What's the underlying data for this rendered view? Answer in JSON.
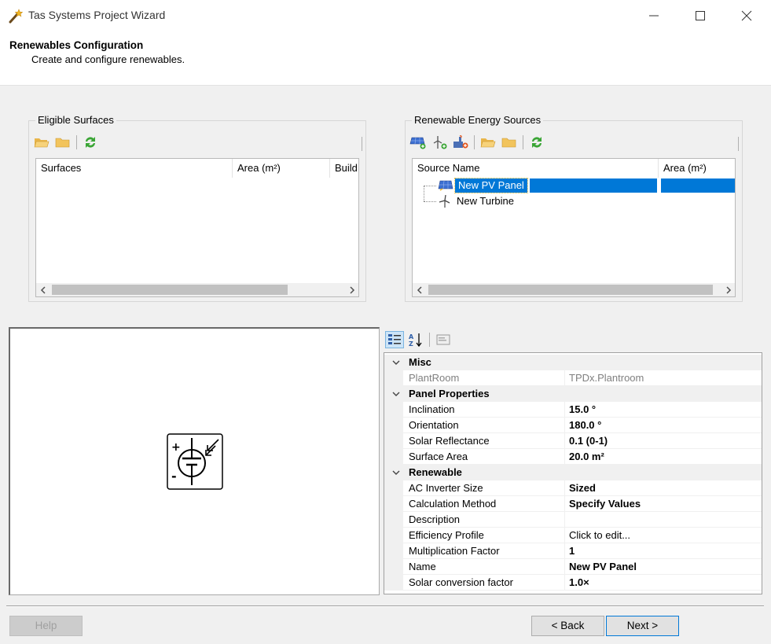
{
  "window": {
    "title": "Tas Systems Project Wizard",
    "controls": [
      "minimize-icon",
      "maximize-icon",
      "close-icon"
    ]
  },
  "header": {
    "title": "Renewables Configuration",
    "subtitle": "Create and configure renewables."
  },
  "eligible_surfaces": {
    "legend": "Eligible Surfaces",
    "toolbar": [
      "folder-open-icon",
      "folder-icon",
      "refresh-icon"
    ],
    "columns": [
      "Surfaces",
      "Area (m²)",
      "Build"
    ]
  },
  "renewable_sources": {
    "legend": "Renewable Energy Sources",
    "toolbar": [
      "add-pv-panel-icon",
      "add-wind-turbine-icon",
      "add-chp-icon",
      "folder-open-icon",
      "folder-icon",
      "refresh-icon"
    ],
    "columns": [
      "Source Name",
      "Area (m²)"
    ],
    "items": [
      {
        "name": "New PV Panel",
        "icon": "pv-panel-icon",
        "selected": true
      },
      {
        "name": "New Turbine",
        "icon": "wind-turbine-icon",
        "selected": false
      }
    ]
  },
  "preview": {
    "symbol": "photovoltaic-cell-symbol-icon"
  },
  "property_grid": {
    "toolbar": [
      "categorized-icon",
      "alphabetical-sort-icon",
      "property-pages-icon"
    ],
    "categories": [
      {
        "name": "Misc",
        "rows": [
          {
            "name": "PlantRoom",
            "value": "TPDx.Plantroom",
            "bold": false,
            "dim": true
          }
        ]
      },
      {
        "name": "Panel Properties",
        "rows": [
          {
            "name": "Inclination",
            "value": "15.0 °",
            "bold": true
          },
          {
            "name": "Orientation",
            "value": "180.0 °",
            "bold": true
          },
          {
            "name": "Solar Reflectance",
            "value": "0.1 (0-1)",
            "bold": true
          },
          {
            "name": "Surface Area",
            "value": "20.0 m²",
            "bold": true
          }
        ]
      },
      {
        "name": "Renewable",
        "rows": [
          {
            "name": "AC Inverter Size",
            "value": "Sized",
            "bold": true
          },
          {
            "name": "Calculation Method",
            "value": "Specify Values",
            "bold": true
          },
          {
            "name": "Description",
            "value": "",
            "bold": false
          },
          {
            "name": "Efficiency Profile",
            "value": "Click to edit...",
            "bold": false
          },
          {
            "name": "Multiplication Factor",
            "value": "1",
            "bold": true
          },
          {
            "name": "Name",
            "value": "New PV Panel",
            "bold": true
          },
          {
            "name": "Solar conversion factor",
            "value": "1.0×",
            "bold": true
          }
        ]
      }
    ]
  },
  "buttons": {
    "help": "Help",
    "back": "< Back",
    "next": "Next >"
  },
  "colors": {
    "selection": "#0078d7",
    "window_bg": "#f0f0f0"
  }
}
